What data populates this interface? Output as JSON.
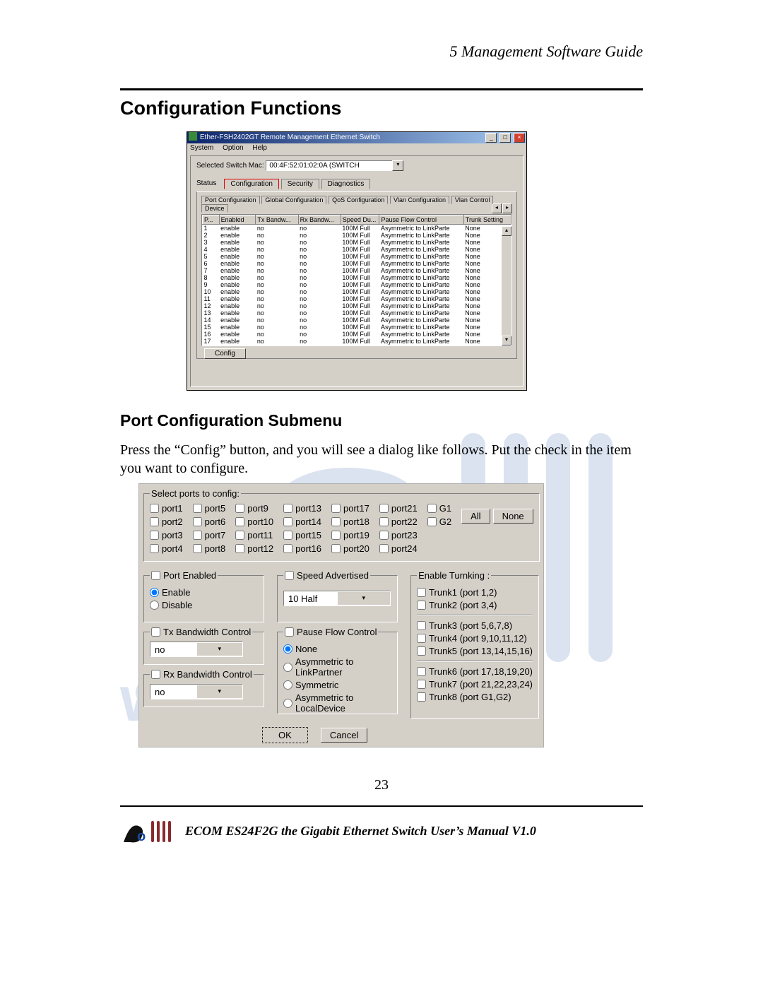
{
  "header_right": "5  Management Software Guide",
  "h1": "Configuration Functions",
  "h2": "Port Configuration Submenu",
  "body_text": "Press the “Config” button, and you will see a dialog like follows. Put the check in the item you want to configure.",
  "page_number": "23",
  "footer_text": "ECOM ES24F2G the Gigabit Ethernet Switch    User’s Manual V1.0",
  "fig1": {
    "title": "Ether-FSH2402GT Remote Management Ethernet Switch",
    "menu": [
      "System",
      "Option",
      "Help"
    ],
    "mac_label": "Selected Switch Mac:",
    "mac_value": "00:4F:52:01:02:0A (SWITCH",
    "status_label": "Status",
    "tabs": {
      "t1": "Configuration",
      "t2": "Security",
      "t3": "Diagnostics"
    },
    "subtabs": {
      "s1": "Port Configuration",
      "s2": "Global Configuration",
      "s3": "QoS Configuration",
      "s4": "Vlan Configuration",
      "s5": "Vlan Control",
      "s6": "Device"
    },
    "cols": {
      "c0": "P...",
      "c1": "Enabled",
      "c2": "Tx Bandw...",
      "c3": "Rx Bandw...",
      "c4": "Speed Du...",
      "c5": "Pause Flow Control",
      "c6": "Trunk Setting"
    },
    "row_enabled": "enable",
    "row_tx": "no",
    "row_rx": "no",
    "row_speed": "100M Full",
    "row_pause": "Asymmetric to LinkParte",
    "row_trunk": "None",
    "config_btn": "Config"
  },
  "fig2": {
    "legend": "Select ports to config:",
    "all": "All",
    "none": "None",
    "port_labels": [
      "port1",
      "port2",
      "port3",
      "port4",
      "port5",
      "port6",
      "port7",
      "port8",
      "port9",
      "port10",
      "port11",
      "port12",
      "port13",
      "port14",
      "port15",
      "port16",
      "port17",
      "port18",
      "port19",
      "port20",
      "port21",
      "port22",
      "port23",
      "port24",
      "G1",
      "G2"
    ],
    "pe_legend": "Port Enabled",
    "pe_enable": "Enable",
    "pe_disable": "Disable",
    "sa_legend": "Speed Advertised",
    "sa_value": "10 Half",
    "tx_legend": "Tx Bandwidth Control",
    "tx_value": "no",
    "rx_legend": "Rx Bandwidth Control",
    "rx_value": "no",
    "pf_legend": "Pause Flow Control",
    "pf_none": "None",
    "pf_alp": "Asymmetric to LinkPartner",
    "pf_sym": "Symmetric",
    "pf_ald": "Asymmetric to LocalDevice",
    "et_legend": "Enable  Turnking :",
    "trunks": [
      "Trunk1 (port 1,2)",
      "Trunk2 (port 3,4)",
      "Trunk3 (port 5,6,7,8)",
      "Trunk4 (port 9,10,11,12)",
      "Trunk5 (port 13,14,15,16)",
      "Trunk6 (port 17,18,19,20)",
      "Trunk7 (port 21,22,23,24)",
      "Trunk8 (port G1,G2)"
    ],
    "ok": "OK",
    "cancel": "Cancel"
  }
}
